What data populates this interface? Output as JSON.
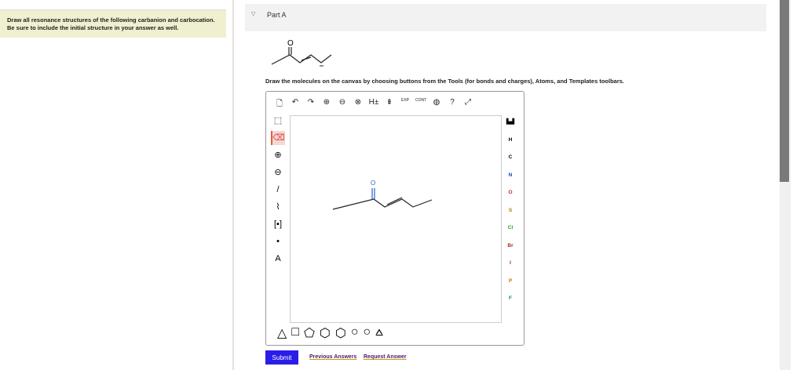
{
  "intro": {
    "line1": "Draw all resonance structures of the following carbanion and carbocation.",
    "line2": "Be sure to include the initial structure in your answer as well."
  },
  "part": {
    "title": "Part A"
  },
  "molecule": {
    "oxygen": "O"
  },
  "instructions": "Draw the molecules on the canvas by choosing buttons from the Tools (for bonds and charges), Atoms, and Templates toolbars.",
  "toolbar": {
    "icons": [
      "new-document-icon",
      "undo-icon",
      "redo-icon",
      "zoom-in-icon",
      "zoom-out-icon",
      "zoom-reset-icon",
      "hydrogen-toggle-icon",
      "2d-clean-icon",
      "exp-icon",
      "cont-icon",
      "info-icon",
      "help-icon",
      "fullscreen-icon"
    ],
    "labels": [
      "🗋",
      "↶",
      "↷",
      "⊕",
      "⊖",
      "⊗",
      "H±",
      "⇟",
      "EXP",
      "CONT",
      "◍",
      "?",
      "⤢"
    ]
  },
  "tools": {
    "labels": [
      "⬚",
      "⌫",
      "⊕",
      "⊖",
      "/",
      "⌇",
      "[▪]",
      "•",
      "A"
    ]
  },
  "atoms": [
    "H",
    "C",
    "N",
    "O",
    "S",
    "Cl",
    "Br",
    "I",
    "P",
    "F"
  ],
  "periodic_label": "▙▟",
  "templates": [
    "△",
    "□",
    "⬠",
    "⬡",
    "⬡",
    "○",
    "○",
    "⩟"
  ],
  "actions": {
    "submit": "Submit",
    "previous": "Previous Answers",
    "request": "Request Answer"
  }
}
